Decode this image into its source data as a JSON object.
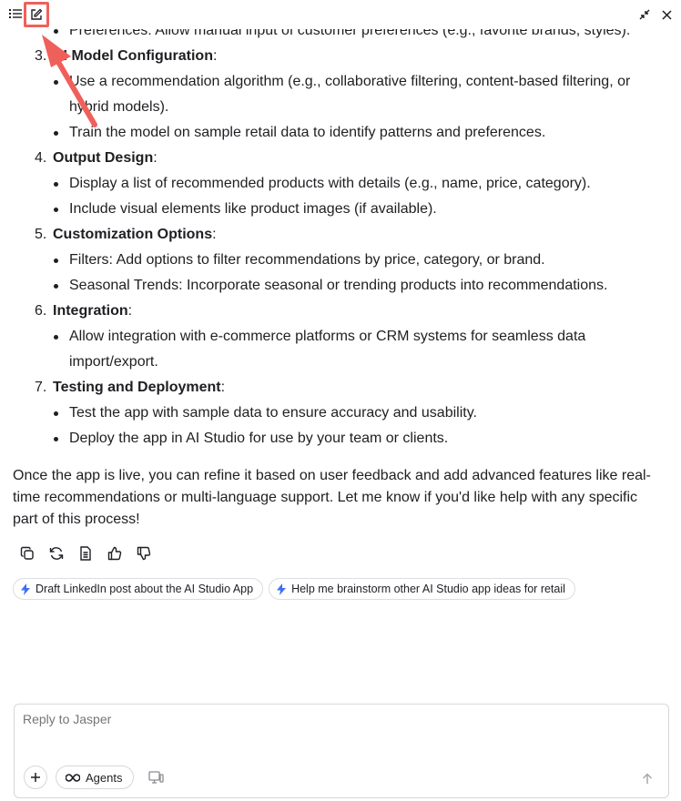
{
  "toolbar": {
    "list_icon": "list-icon",
    "edit_icon": "edit-icon",
    "minimize_icon": "minimize-icon",
    "close_icon": "close-icon",
    "highlight_color": "#f0605a"
  },
  "content": {
    "partial_bullet": "Preferences: Allow manual input of customer preferences (e.g., favorite brands, styles).",
    "sections": [
      {
        "number": "3.",
        "title": "AI Model Configuration",
        "bullets": [
          "Use a recommendation algorithm (e.g., collaborative filtering, content-based filtering, or hybrid models).",
          "Train the model on sample retail data to identify patterns and preferences."
        ]
      },
      {
        "number": "4.",
        "title": "Output Design",
        "bullets": [
          "Display a list of recommended products with details (e.g., name, price, category).",
          "Include visual elements like product images (if available)."
        ]
      },
      {
        "number": "5.",
        "title": "Customization Options",
        "bullets": [
          "Filters: Add options to filter recommendations by price, category, or brand.",
          "Seasonal Trends: Incorporate seasonal or trending products into recommendations."
        ]
      },
      {
        "number": "6.",
        "title": "Integration",
        "bullets": [
          "Allow integration with e-commerce platforms or CRM systems for seamless data import/export."
        ]
      },
      {
        "number": "7.",
        "title": "Testing and Deployment",
        "bullets": [
          "Test the app with sample data to ensure accuracy and usability.",
          "Deploy the app in AI Studio for use by your team or clients."
        ]
      }
    ],
    "outro": "Once the app is live, you can refine it based on user feedback and add advanced features like real-time recommendations or multi-language support. Let me know if you'd like help with any specific part of this process!"
  },
  "actions": [
    "copy-icon",
    "regenerate-icon",
    "document-icon",
    "thumbs-up-icon",
    "thumbs-down-icon"
  ],
  "suggestions": [
    {
      "icon": "lightning-icon",
      "label": "Draft LinkedIn post about the AI Studio App"
    },
    {
      "icon": "lightning-icon",
      "label": "Help me brainstorm other AI Studio app ideas for retail"
    }
  ],
  "composer": {
    "placeholder": "Reply to Jasper",
    "agents_label": "Agents",
    "plus_icon": "plus-icon",
    "agents_icon": "infinity-icon",
    "device_icon": "device-icon",
    "send_icon": "arrow-up-icon"
  },
  "accent_color": "#3b6ff5"
}
